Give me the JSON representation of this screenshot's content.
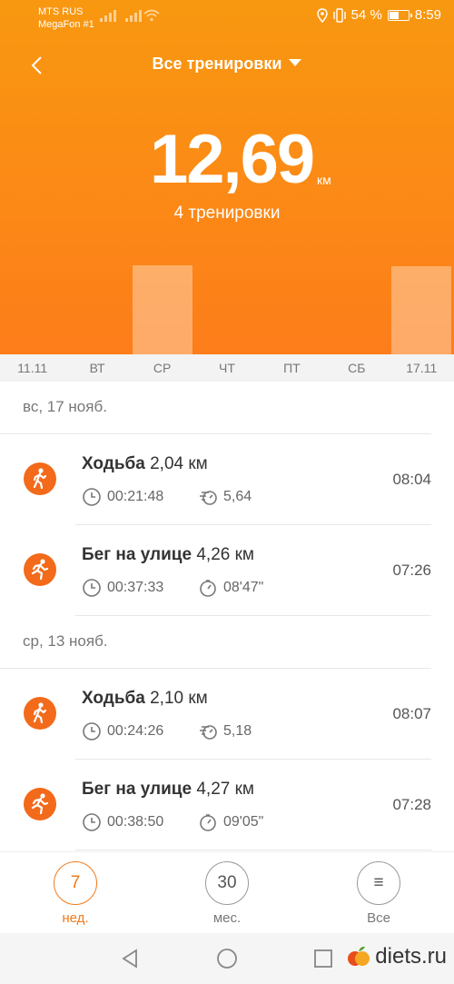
{
  "status": {
    "carrier1": "MTS RUS",
    "carrier2": "MegaFon #1",
    "battery": "54 %",
    "time": "8:59",
    "battery_level": 0.54
  },
  "header": {
    "title": "Все тренировки",
    "distance": "12,69",
    "unit": "км",
    "count": "4 тренировки"
  },
  "chart_data": {
    "type": "bar",
    "categories": [
      "11.11",
      "ВТ",
      "СР",
      "ЧТ",
      "ПТ",
      "СБ",
      "17.11"
    ],
    "values": [
      0,
      0,
      6.37,
      0,
      0,
      0,
      6.3
    ]
  },
  "groups": [
    {
      "date": "вс, 17 нояб.",
      "items": [
        {
          "type": "Ходьба",
          "distance": "2,04 км",
          "duration": "00:21:48",
          "metric": "5,64",
          "time": "08:04",
          "kind": "walk"
        },
        {
          "type": "Бег на улице",
          "distance": "4,26 км",
          "duration": "00:37:33",
          "metric": "08'47\"",
          "time": "07:26",
          "kind": "run"
        }
      ]
    },
    {
      "date": "ср, 13 нояб.",
      "items": [
        {
          "type": "Ходьба",
          "distance": "2,10 км",
          "duration": "00:24:26",
          "metric": "5,18",
          "time": "08:07",
          "kind": "walk"
        },
        {
          "type": "Бег на улице",
          "distance": "4,27 км",
          "duration": "00:38:50",
          "metric": "09'05\"",
          "time": "07:28",
          "kind": "run"
        }
      ]
    }
  ],
  "tabs": [
    {
      "value": "7",
      "label": "нед."
    },
    {
      "value": "30",
      "label": "мес."
    },
    {
      "value": "≡",
      "label": "Все"
    }
  ],
  "watermark": "diets.ru",
  "colors": {
    "accent": "#f07a1a",
    "icon": "#f26a1a"
  }
}
